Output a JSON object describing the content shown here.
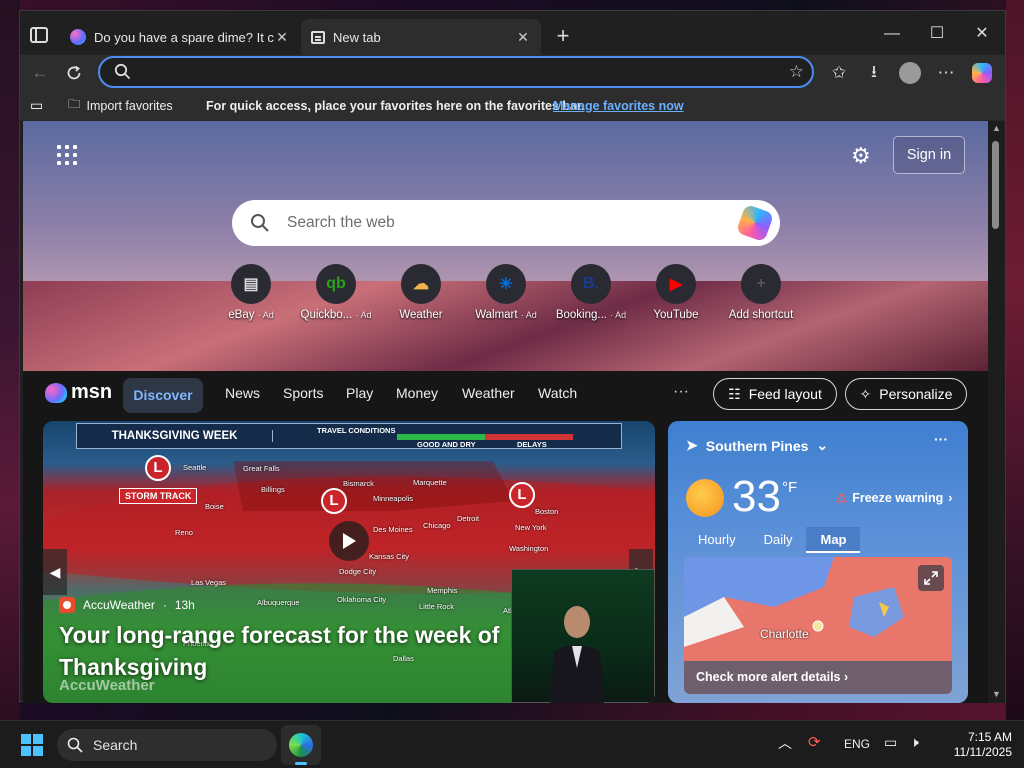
{
  "browser": {
    "tabs": [
      {
        "title": "Do you have a spare dime? It coul"
      },
      {
        "title": "New tab"
      }
    ],
    "favorites_bar": {
      "import_label": "Import favorites",
      "message": "For quick access, place your favorites here on the favorites bar.",
      "manage_link": "Manage favorites now"
    }
  },
  "newtab": {
    "sign_in": "Sign in",
    "search_placeholder": "Search the web",
    "shortcuts": [
      {
        "label": "eBay",
        "ad": "· Ad",
        "icon": "ebay-bag-icon",
        "color": "#d8d8d8"
      },
      {
        "label": "Quickbo...",
        "ad": "· Ad",
        "icon": "quickbooks-icon",
        "color": "#2ca01c"
      },
      {
        "label": "Weather",
        "ad": "",
        "icon": "weather-icon",
        "color": "#f0b44a"
      },
      {
        "label": "Walmart",
        "ad": "· Ad",
        "icon": "walmart-icon",
        "color": "#0071dc"
      },
      {
        "label": "Booking...",
        "ad": "· Ad",
        "icon": "booking-icon",
        "color": "#1a3c8f"
      },
      {
        "label": "YouTube",
        "ad": "",
        "icon": "youtube-icon",
        "color": "#ff0000"
      },
      {
        "label": "Add shortcut",
        "ad": "",
        "icon": "plus-icon",
        "color": "#555"
      }
    ]
  },
  "msn": {
    "logo": "msn",
    "nav": [
      "Discover",
      "News",
      "Sports",
      "Play",
      "Money",
      "Weather",
      "Watch"
    ],
    "more": "···",
    "feed_layout": "Feed layout",
    "personalize": "Personalize"
  },
  "hero": {
    "banner_title": "THANKSGIVING WEEK",
    "travel_conditions": "TRAVEL CONDITIONS",
    "good_and_dry": "GOOD AND DRY",
    "delays": "DELAYS",
    "storm_track": "STORM TRACK",
    "low_label": "L",
    "cities": [
      "Seattle",
      "Great Falls",
      "Billings",
      "Bismarck",
      "Marquette",
      "Minneapolis",
      "Boise",
      "Detroit",
      "Boston",
      "Des Moines",
      "Chicago",
      "New York",
      "Reno",
      "Washington",
      "Kansas City",
      "Las Vegas",
      "Dodge City",
      "Albuquerque",
      "Oklahoma City",
      "Memphis",
      "Little Rock",
      "Atlanta",
      "Phoenix",
      "Dallas"
    ],
    "source": "AccuWeather",
    "age": "13h",
    "title": "Your long-range forecast for the week of Thanksgiving",
    "watermark": "AccuWeather"
  },
  "weather": {
    "location": "Southern Pines",
    "more": "···",
    "temperature": "33",
    "unit": "°F",
    "alert": "Freeze warning",
    "tabs": [
      "Hourly",
      "Daily",
      "Map"
    ],
    "active_tab": "Map",
    "map_city": "Charlotte",
    "alert_link": "Check more alert details"
  },
  "taskbar": {
    "search": "Search",
    "lang": "ENG",
    "time": "7:15 AM",
    "date": "11/11/2025"
  }
}
